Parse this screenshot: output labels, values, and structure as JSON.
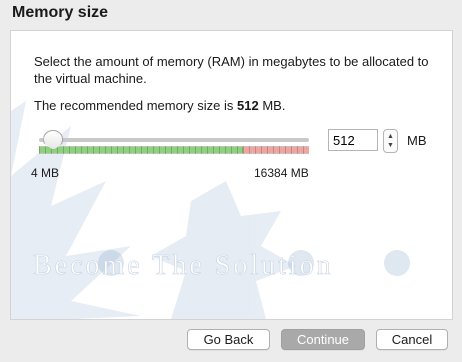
{
  "window": {
    "title": "Memory size"
  },
  "content": {
    "description": "Select the amount of memory (RAM) in megabytes to be allocated to the virtual machine.",
    "recommended_prefix": "The recommended memory size is ",
    "recommended_value": "512",
    "recommended_suffix": " MB."
  },
  "memory": {
    "min_label": "4 MB",
    "max_label": "16384 MB",
    "value": "512",
    "unit": "MB",
    "slider_fraction": 0.031
  },
  "watermark": {
    "text": "Become The Solution"
  },
  "buttons": {
    "back": "Go Back",
    "continue": "Continue",
    "cancel": "Cancel"
  },
  "colors": {
    "safe_range": "#8bd27a",
    "danger_range": "#f2a5a0",
    "continue_disabled": "#a9a9a9"
  }
}
